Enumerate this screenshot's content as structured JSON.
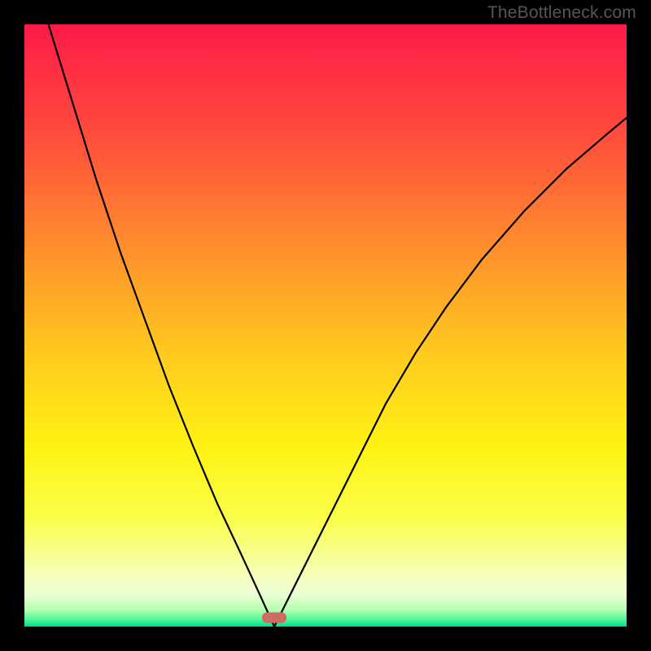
{
  "watermark": "TheBottleneck.com",
  "gradient": {
    "stops": [
      {
        "offset": 0.0,
        "color": "#ff1a49"
      },
      {
        "offset": 0.18,
        "color": "#ff4b3c"
      },
      {
        "offset": 0.36,
        "color": "#ff8b2e"
      },
      {
        "offset": 0.54,
        "color": "#ffc81f"
      },
      {
        "offset": 0.7,
        "color": "#fff213"
      },
      {
        "offset": 0.82,
        "color": "#fbff4a"
      },
      {
        "offset": 0.9,
        "color": "#f6ffa8"
      },
      {
        "offset": 0.945,
        "color": "#eeffd6"
      },
      {
        "offset": 0.972,
        "color": "#b6ffb1"
      },
      {
        "offset": 0.988,
        "color": "#53f59a"
      },
      {
        "offset": 1.0,
        "color": "#00e08a"
      }
    ]
  },
  "marker": {
    "x_frac": 0.415,
    "y_frac": 0.985
  },
  "chart_data": {
    "type": "line",
    "title": "",
    "xlabel": "",
    "ylabel": "",
    "xlim": [
      0,
      1
    ],
    "ylim": [
      0,
      1
    ],
    "note": "V-shaped bottleneck curve. x≈0.415 is the optimum (y≈0). Background gradient encodes severity: green (bottom / good) → red (top / bad). Values are estimated fractional coordinates inside the plot area.",
    "series": [
      {
        "name": "left-branch",
        "x": [
          0.04,
          0.08,
          0.12,
          0.16,
          0.2,
          0.24,
          0.28,
          0.32,
          0.36,
          0.39,
          0.415
        ],
        "y": [
          1.0,
          0.87,
          0.74,
          0.62,
          0.51,
          0.4,
          0.3,
          0.205,
          0.12,
          0.055,
          0.0
        ]
      },
      {
        "name": "right-branch",
        "x": [
          0.415,
          0.44,
          0.48,
          0.52,
          0.56,
          0.6,
          0.65,
          0.7,
          0.76,
          0.83,
          0.9,
          0.97,
          1.0
        ],
        "y": [
          0.0,
          0.05,
          0.13,
          0.21,
          0.29,
          0.37,
          0.455,
          0.53,
          0.61,
          0.69,
          0.76,
          0.82,
          0.845
        ]
      }
    ],
    "marker": {
      "x": 0.415,
      "y": 0.015,
      "shape": "rounded-bar",
      "color": "#cf6b63"
    }
  }
}
